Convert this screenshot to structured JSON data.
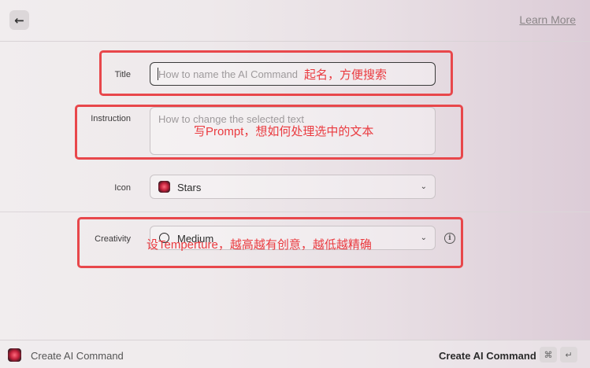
{
  "header": {
    "back_glyph": "←",
    "learn_more": "Learn More"
  },
  "form": {
    "title": {
      "label": "Title",
      "placeholder": "How to name the AI Command"
    },
    "instruction": {
      "label": "Instruction",
      "placeholder": "How to change the selected text"
    },
    "icon": {
      "label": "Icon",
      "value": "Stars",
      "icon_name": "stars-icon"
    },
    "creativity": {
      "label": "Creativity",
      "value": "Medium",
      "icon_name": "gauge-icon"
    }
  },
  "annotations": {
    "title_note": "起名，方便搜索",
    "instruction_note": "写Prompt，想如何处理选中的文本",
    "creativity_note": "设Temperture，越高越有创意，越低越精确",
    "color": "#e8474b"
  },
  "footer": {
    "title": "Create AI Command",
    "action_label": "Create AI Command",
    "shortcut_mod": "⌘",
    "shortcut_key": "↵"
  }
}
